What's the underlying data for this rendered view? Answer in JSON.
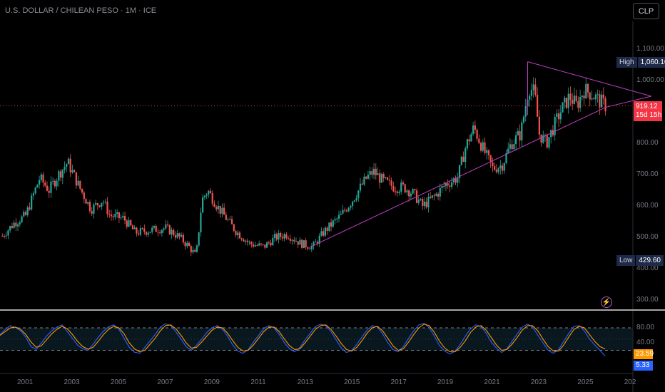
{
  "header": {
    "title": "U.S. DOLLAR / CHILEAN PESO · 1M · ICE",
    "currency_button": "CLP"
  },
  "colors": {
    "up": "#26a69a",
    "down": "#ef5350",
    "trendline": "#c13fc2",
    "k_line": "#2962ff",
    "d_line": "#ff9800",
    "last_price": "#f23645"
  },
  "price_scale": {
    "ticks": [
      "1,100.00",
      "1,000.00",
      "900.00",
      "800.00",
      "700.00",
      "600.00",
      "500.00",
      "400.00",
      "300.00"
    ]
  },
  "markers": {
    "high_label": "High",
    "high_value": "1,060.10",
    "low_label": "Low",
    "low_value": "429.60",
    "last_price": "919.12",
    "countdown": "15d 15h"
  },
  "oscillator": {
    "ticks": [
      "80.00",
      "40.00"
    ],
    "d_value": "23.59",
    "k_value": "5.33",
    "upper_band": 80,
    "lower_band": 20,
    "mid": 50
  },
  "time_axis": {
    "labels": [
      "2001",
      "2003",
      "2005",
      "2007",
      "2009",
      "2011",
      "2013",
      "2015",
      "2017",
      "2019",
      "2021",
      "2023",
      "2025",
      "202"
    ]
  },
  "icons": {
    "bolt": "lightning-icon"
  },
  "chart_data": {
    "type": "candlestick",
    "title": "U.S. DOLLAR / CHILEAN PESO · 1M · ICE",
    "ylim": [
      270,
      1150
    ],
    "last_price": 919.12,
    "high": 1060.1,
    "low": 429.6,
    "price_path": [
      [
        2000.0,
        505
      ],
      [
        2000.5,
        545
      ],
      [
        2001.0,
        570
      ],
      [
        2001.6,
        690
      ],
      [
        2002.0,
        650
      ],
      [
        2002.4,
        700
      ],
      [
        2002.8,
        740
      ],
      [
        2003.3,
        660
      ],
      [
        2003.8,
        590
      ],
      [
        2004.3,
        620
      ],
      [
        2004.6,
        570
      ],
      [
        2005.2,
        560
      ],
      [
        2005.7,
        515
      ],
      [
        2006.5,
        525
      ],
      [
        2007.0,
        530
      ],
      [
        2007.6,
        500
      ],
      [
        2008.0,
        470
      ],
      [
        2008.3,
        440
      ],
      [
        2008.55,
        620
      ],
      [
        2008.8,
        650
      ],
      [
        2009.2,
        600
      ],
      [
        2009.6,
        560
      ],
      [
        2010.0,
        520
      ],
      [
        2010.6,
        480
      ],
      [
        2011.2,
        470
      ],
      [
        2011.7,
        500
      ],
      [
        2012.2,
        510
      ],
      [
        2012.8,
        480
      ],
      [
        2013.3,
        470
      ],
      [
        2013.8,
        520
      ],
      [
        2014.5,
        570
      ],
      [
        2015.0,
        620
      ],
      [
        2015.6,
        690
      ],
      [
        2015.9,
        710
      ],
      [
        2016.3,
        680
      ],
      [
        2016.8,
        660
      ],
      [
        2017.2,
        660
      ],
      [
        2017.6,
        640
      ],
      [
        2018.0,
        600
      ],
      [
        2018.5,
        630
      ],
      [
        2019.0,
        670
      ],
      [
        2019.5,
        690
      ],
      [
        2019.85,
        790
      ],
      [
        2020.2,
        850
      ],
      [
        2020.6,
        780
      ],
      [
        2021.0,
        720
      ],
      [
        2021.4,
        730
      ],
      [
        2021.8,
        800
      ],
      [
        2022.2,
        830
      ],
      [
        2022.55,
        980
      ],
      [
        2022.8,
        960
      ],
      [
        2023.0,
        830
      ],
      [
        2023.3,
        800
      ],
      [
        2023.6,
        850
      ],
      [
        2023.9,
        900
      ],
      [
        2024.3,
        950
      ],
      [
        2024.6,
        920
      ],
      [
        2024.9,
        970
      ],
      [
        2025.2,
        960
      ],
      [
        2025.5,
        940
      ],
      [
        2025.85,
        919.12
      ]
    ],
    "trendlines": [
      {
        "name": "support",
        "points": [
          [
            2013.2,
            470
          ],
          [
            2025.85,
            915
          ]
        ]
      },
      {
        "name": "resistance",
        "points": [
          [
            2022.5,
            1060
          ],
          [
            2027.8,
            950
          ]
        ]
      },
      {
        "name": "support-extension",
        "points": [
          [
            2025.85,
            915
          ],
          [
            2027.8,
            950
          ]
        ]
      }
    ],
    "oscillator_series": [
      {
        "name": "%K",
        "values": [
          62,
          75,
          86,
          81,
          72,
          55,
          30,
          22,
          40,
          58,
          72,
          82,
          88,
          70,
          52,
          34,
          24,
          20,
          36,
          55,
          71,
          83,
          88,
          76,
          52,
          28,
          15,
          12,
          28,
          45,
          62,
          82,
          91,
          86,
          70,
          50,
          30,
          20,
          34,
          50,
          68,
          80,
          86,
          76,
          58,
          34,
          18,
          12,
          22,
          42,
          60,
          78,
          86,
          80,
          62,
          40,
          24,
          16,
          28,
          48,
          66,
          84,
          90,
          86,
          70,
          48,
          26,
          14,
          20,
          36,
          56,
          74,
          86,
          82,
          64,
          40,
          22,
          16,
          30,
          52,
          72,
          88,
          92,
          80,
          58,
          32,
          18,
          10,
          18,
          36,
          58,
          78,
          88,
          84,
          66,
          42,
          26,
          14,
          24,
          44,
          64,
          82,
          90,
          82,
          60,
          40,
          20,
          12,
          22,
          44,
          66,
          84,
          86,
          72,
          50,
          34,
          20,
          5
        ]
      },
      {
        "name": "%D",
        "values": [
          60,
          70,
          80,
          82,
          76,
          62,
          42,
          28,
          32,
          48,
          64,
          76,
          84,
          78,
          62,
          44,
          30,
          23,
          28,
          44,
          62,
          76,
          84,
          80,
          64,
          40,
          24,
          16,
          20,
          36,
          52,
          72,
          86,
          88,
          78,
          60,
          40,
          26,
          28,
          42,
          58,
          74,
          82,
          80,
          66,
          46,
          28,
          18,
          20,
          34,
          52,
          70,
          82,
          82,
          70,
          50,
          32,
          22,
          24,
          40,
          58,
          76,
          86,
          88,
          76,
          58,
          38,
          22,
          18,
          28,
          46,
          66,
          80,
          84,
          72,
          52,
          32,
          20,
          24,
          42,
          62,
          80,
          90,
          86,
          68,
          44,
          26,
          16,
          16,
          28,
          46,
          68,
          82,
          86,
          74,
          54,
          34,
          20,
          22,
          36,
          54,
          74,
          86,
          86,
          72,
          50,
          30,
          18,
          18,
          34,
          56,
          76,
          84,
          80,
          62,
          44,
          30,
          23.59
        ]
      }
    ]
  }
}
